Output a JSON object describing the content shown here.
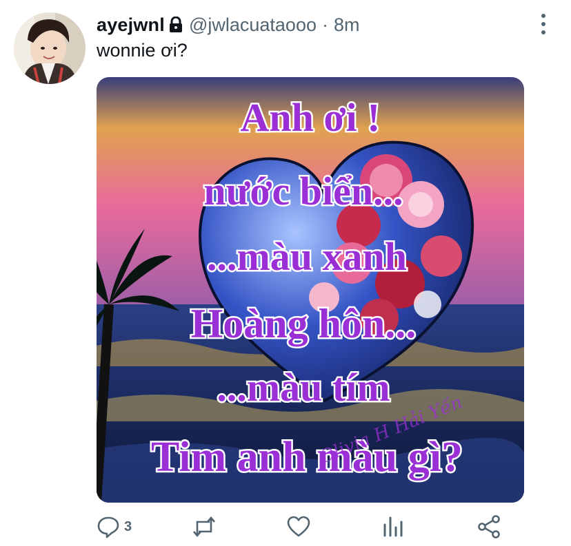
{
  "tweet": {
    "display_name": "ayejwnl",
    "handle": "@jwlacuataooo",
    "separator": "·",
    "time": "8m",
    "text": "wonnie ơi?",
    "image_lines": [
      "Anh ơi !",
      "nước biển...",
      "...màu xanh",
      "Hoàng hôn...",
      "...màu tím",
      "Tim anh màu gì?"
    ],
    "image_watermark": "Olivia H Hải Yến",
    "actions": {
      "reply_count": "3"
    }
  },
  "colors": {
    "text": "#0f1419",
    "secondary": "#536471",
    "image_text": "#9b2fd6"
  },
  "icons": [
    "lock-icon",
    "more-options-icon",
    "reply-icon",
    "retweet-icon",
    "like-icon",
    "analytics-icon",
    "share-icon"
  ]
}
